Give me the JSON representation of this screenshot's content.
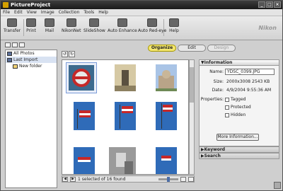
{
  "window": {
    "title": "PictureProject",
    "min": "_",
    "max": "□",
    "close": "×"
  },
  "menu": [
    "File",
    "Edit",
    "View",
    "Image",
    "Collection",
    "Tools",
    "Help"
  ],
  "toolbar": {
    "transfer": "Transfer",
    "print": "Print",
    "mail": "Mail",
    "nikonnet": "NikonNet",
    "slideshow": "SlideShow",
    "auto_enhance": "Auto Enhance",
    "auto_redeye": "Auto Red-eye",
    "help": "Help",
    "brand": "Nikon"
  },
  "modes": {
    "organize": "Organize",
    "edit": "Edit",
    "design": "Design"
  },
  "tree": [
    {
      "label": "All Photos"
    },
    {
      "label": "Last Import"
    },
    {
      "label": "New folder"
    }
  ],
  "status": {
    "text": "1 selected of 16 found"
  },
  "info_panel": {
    "header": "Information",
    "name_label": "Name:",
    "name_value": "YDSC_0399.JPG",
    "size_label": "Size:",
    "size_value": "2000x3008 2543 KB",
    "date_label": "Date:",
    "date_value": "4/9/2004 9:55:36 AM",
    "properties_label": "Properties:",
    "tagged": "Tagged",
    "protected": "Protected",
    "hidden": "Hidden",
    "more_button": "More Information..."
  },
  "keyword_panel": {
    "header": "Keyword"
  },
  "search_panel": {
    "header": "Search"
  }
}
